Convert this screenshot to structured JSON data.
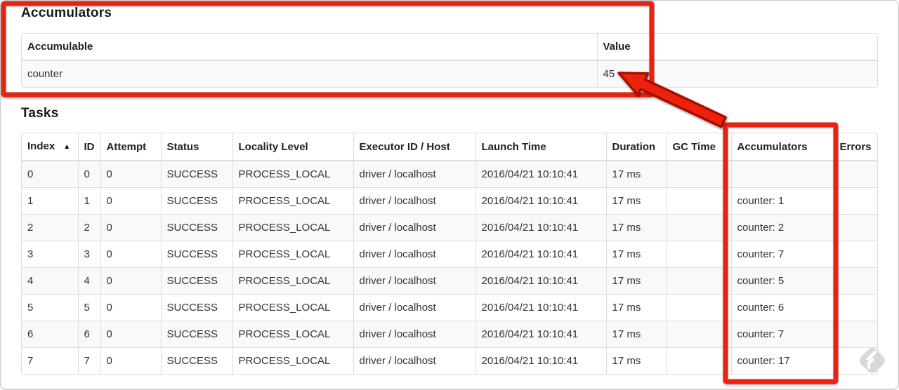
{
  "accumulators_section": {
    "heading": "Accumulators",
    "table": {
      "headers": {
        "accumulable": "Accumulable",
        "value": "Value"
      },
      "rows": [
        {
          "accumulable": "counter",
          "value": "45"
        }
      ]
    }
  },
  "tasks_section": {
    "heading": "Tasks",
    "table": {
      "headers": {
        "index": "Index",
        "id": "ID",
        "attempt": "Attempt",
        "status": "Status",
        "locality_level": "Locality Level",
        "executor_id_host": "Executor ID / Host",
        "launch_time": "Launch Time",
        "duration": "Duration",
        "gc_time": "GC Time",
        "accumulators": "Accumulators",
        "errors": "Errors"
      },
      "sort": {
        "column": "Index",
        "direction": "ascending",
        "icon": "▲"
      },
      "rows": [
        {
          "index": "0",
          "id": "0",
          "attempt": "0",
          "status": "SUCCESS",
          "locality_level": "PROCESS_LOCAL",
          "executor_id_host": "driver / localhost",
          "launch_time": "2016/04/21 10:10:41",
          "duration": "17 ms",
          "gc_time": "",
          "accumulators": "",
          "errors": ""
        },
        {
          "index": "1",
          "id": "1",
          "attempt": "0",
          "status": "SUCCESS",
          "locality_level": "PROCESS_LOCAL",
          "executor_id_host": "driver / localhost",
          "launch_time": "2016/04/21 10:10:41",
          "duration": "17 ms",
          "gc_time": "",
          "accumulators": "counter: 1",
          "errors": ""
        },
        {
          "index": "2",
          "id": "2",
          "attempt": "0",
          "status": "SUCCESS",
          "locality_level": "PROCESS_LOCAL",
          "executor_id_host": "driver / localhost",
          "launch_time": "2016/04/21 10:10:41",
          "duration": "17 ms",
          "gc_time": "",
          "accumulators": "counter: 2",
          "errors": ""
        },
        {
          "index": "3",
          "id": "3",
          "attempt": "0",
          "status": "SUCCESS",
          "locality_level": "PROCESS_LOCAL",
          "executor_id_host": "driver / localhost",
          "launch_time": "2016/04/21 10:10:41",
          "duration": "17 ms",
          "gc_time": "",
          "accumulators": "counter: 7",
          "errors": ""
        },
        {
          "index": "4",
          "id": "4",
          "attempt": "0",
          "status": "SUCCESS",
          "locality_level": "PROCESS_LOCAL",
          "executor_id_host": "driver / localhost",
          "launch_time": "2016/04/21 10:10:41",
          "duration": "17 ms",
          "gc_time": "",
          "accumulators": "counter: 5",
          "errors": ""
        },
        {
          "index": "5",
          "id": "5",
          "attempt": "0",
          "status": "SUCCESS",
          "locality_level": "PROCESS_LOCAL",
          "executor_id_host": "driver / localhost",
          "launch_time": "2016/04/21 10:10:41",
          "duration": "17 ms",
          "gc_time": "",
          "accumulators": "counter: 6",
          "errors": ""
        },
        {
          "index": "6",
          "id": "6",
          "attempt": "0",
          "status": "SUCCESS",
          "locality_level": "PROCESS_LOCAL",
          "executor_id_host": "driver / localhost",
          "launch_time": "2016/04/21 10:10:41",
          "duration": "17 ms",
          "gc_time": "",
          "accumulators": "counter: 7",
          "errors": ""
        },
        {
          "index": "7",
          "id": "7",
          "attempt": "0",
          "status": "SUCCESS",
          "locality_level": "PROCESS_LOCAL",
          "executor_id_host": "driver / localhost",
          "launch_time": "2016/04/21 10:10:41",
          "duration": "17 ms",
          "gc_time": "",
          "accumulators": "counter: 17",
          "errors": ""
        }
      ]
    }
  },
  "annotations": {
    "highlight_color": "#ed2110",
    "arrow_outline_color": "#a81104",
    "arrow_points_to_value": "45"
  },
  "icons": {
    "sort_ascending": "▲",
    "watermark_fill": "#d8d8d8"
  }
}
